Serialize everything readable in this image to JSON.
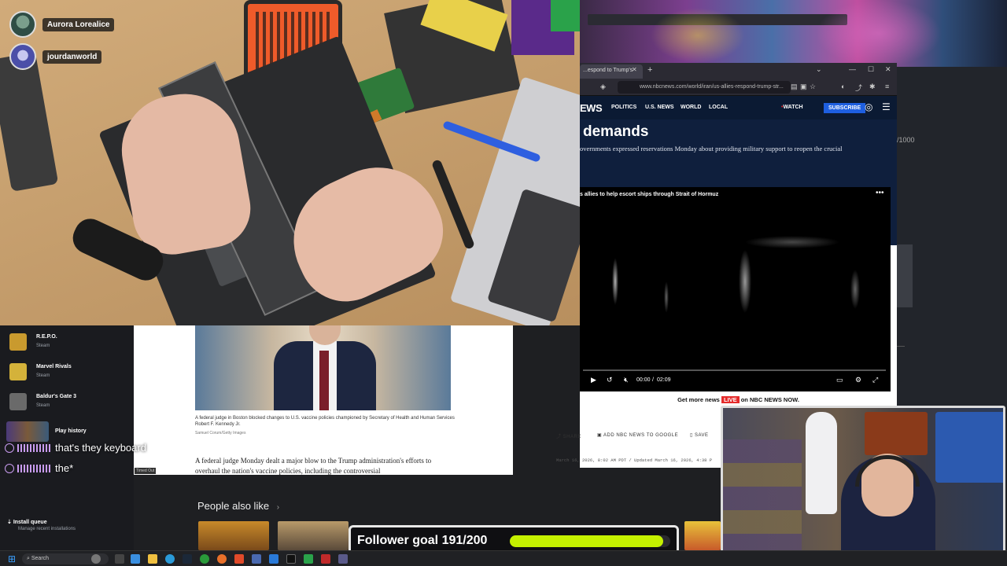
{
  "participants": [
    {
      "name": "Aurora Lorealice"
    },
    {
      "name": "jourdanworld"
    }
  ],
  "browser": {
    "tab_title": "...espond to Trump's",
    "url": "www.nbcnews.com/world/iran/us-allies-respond-trump-str...",
    "logo": "EWS",
    "nav": [
      "POLITICS",
      "U.S. NEWS",
      "WORLD",
      "LOCAL"
    ],
    "watch_label": "WATCH",
    "subscribe_label": "SUBSCRIBE",
    "headline": "demands",
    "dek": "overnments expressed reservations Monday about providing military support to reopen the crucial",
    "video_title": "s allies to help escort ships through Strait of Hormuz",
    "time_current": "00:00",
    "time_total": "02:09",
    "get_more_pre": "Get more news",
    "live_badge": "LIVE",
    "get_more_on": "on",
    "get_more_post": "NBC NEWS NOW.",
    "share_label": "SHARE",
    "google_label": "ADD NBC NEWS TO GOOGLE",
    "save_label": "SAVE",
    "dateline": "March 16, 2026, 8:02 AM PDT / Updated March 16, 2026, 4:38 P"
  },
  "article": {
    "caption": "A federal judge in Boston blocked changes to U.S. vaccine policies championed by Secretary of Health and Human Services Robert F. Kennedy Jr.",
    "credit": "Samuel Corum/Getty Images",
    "body": "A federal judge Monday dealt a major blow to the Trump administration's efforts to overhaul the nation's vaccine policies, including the controversial"
  },
  "library": {
    "games": [
      {
        "name": "R.E.P.O.",
        "sub": "Steam",
        "color": "#c99a2e"
      },
      {
        "name": "Marvel Rivals",
        "sub": "Steam",
        "color": "#d4b23a"
      },
      {
        "name": "Baldur's Gate 3",
        "sub": "Steam",
        "color": "#6a6a6a"
      }
    ],
    "play_history": "Play history",
    "install_title": "Install queue",
    "install_sub": "Manage recent installations"
  },
  "chat": [
    {
      "message": "that's they keyboard"
    },
    {
      "message": "the*"
    }
  ],
  "timed_out": "Timed Out",
  "people_also_like": "People also like",
  "steam_right": {
    "counter": "/1000"
  },
  "follower_goal": {
    "label": "Follower goal 191/200",
    "current": 191,
    "target": 200
  },
  "taskbar": {
    "search_placeholder": "Search"
  },
  "colors": {
    "accent_goal": "#c4f000",
    "nbc_navy": "#0b1a33",
    "live_red": "#e52b2b"
  }
}
